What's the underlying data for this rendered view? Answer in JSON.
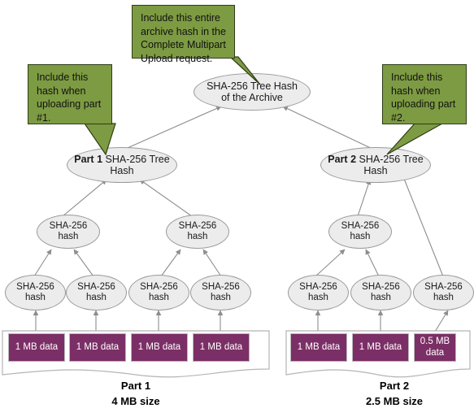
{
  "diagram": {
    "title": "SHA-256 Tree Hash multipart upload diagram",
    "colors": {
      "callout_fill": "#7d9b42",
      "callout_border": "#2f3d16",
      "node_fill": "#ececec",
      "node_border": "#9a9a9a",
      "data_fill": "#7b2f66",
      "edge": "#8d8d8d",
      "background": "#ffffff"
    }
  },
  "callouts": [
    {
      "id": "callout-archive",
      "text": "Include this entire archive hash in the Complete Multipart Upload request."
    },
    {
      "id": "callout-part1",
      "text": "Include this hash when uploading part #1."
    },
    {
      "id": "callout-part2",
      "text": "Include this hash when uploading part #2."
    }
  ],
  "nodes": {
    "root": {
      "line1": "SHA-256 Tree Hash",
      "line2": "of the Archive"
    },
    "part1_tree": {
      "bold": "Part 1",
      "rest": " SHA-256 Tree Hash"
    },
    "part2_tree": {
      "bold": "Part 2",
      "rest": " SHA-256 Tree Hash"
    },
    "hash_label": {
      "line1": "SHA-256",
      "line2": "hash"
    }
  },
  "mid_hashes": [
    {
      "id": "mid-1",
      "line1": "SHA-256",
      "line2": "hash"
    },
    {
      "id": "mid-2",
      "line1": "SHA-256",
      "line2": "hash"
    },
    {
      "id": "mid-3",
      "line1": "SHA-256",
      "line2": "hash"
    }
  ],
  "leaf_hashes": [
    {
      "id": "leaf-1",
      "line1": "SHA-256",
      "line2": "hash"
    },
    {
      "id": "leaf-2",
      "line1": "SHA-256",
      "line2": "hash"
    },
    {
      "id": "leaf-3",
      "line1": "SHA-256",
      "line2": "hash"
    },
    {
      "id": "leaf-4",
      "line1": "SHA-256",
      "line2": "hash"
    },
    {
      "id": "leaf-5",
      "line1": "SHA-256",
      "line2": "hash"
    },
    {
      "id": "leaf-6",
      "line1": "SHA-256",
      "line2": "hash"
    },
    {
      "id": "leaf-7",
      "line1": "SHA-256",
      "line2": "hash"
    }
  ],
  "parts": [
    {
      "id": "part-1",
      "label": "Part 1\n4 MB size",
      "blocks": [
        {
          "id": "p1-b1",
          "text": "1 MB data"
        },
        {
          "id": "p1-b2",
          "text": "1 MB data"
        },
        {
          "id": "p1-b3",
          "text": "1 MB data"
        },
        {
          "id": "p1-b4",
          "text": "1 MB data"
        }
      ]
    },
    {
      "id": "part-2",
      "label": "Part 2\n2.5 MB size",
      "blocks": [
        {
          "id": "p2-b1",
          "text": "1 MB data"
        },
        {
          "id": "p2-b2",
          "text": "1 MB data"
        },
        {
          "id": "p2-b3",
          "text": "0.5  MB data"
        }
      ]
    }
  ]
}
